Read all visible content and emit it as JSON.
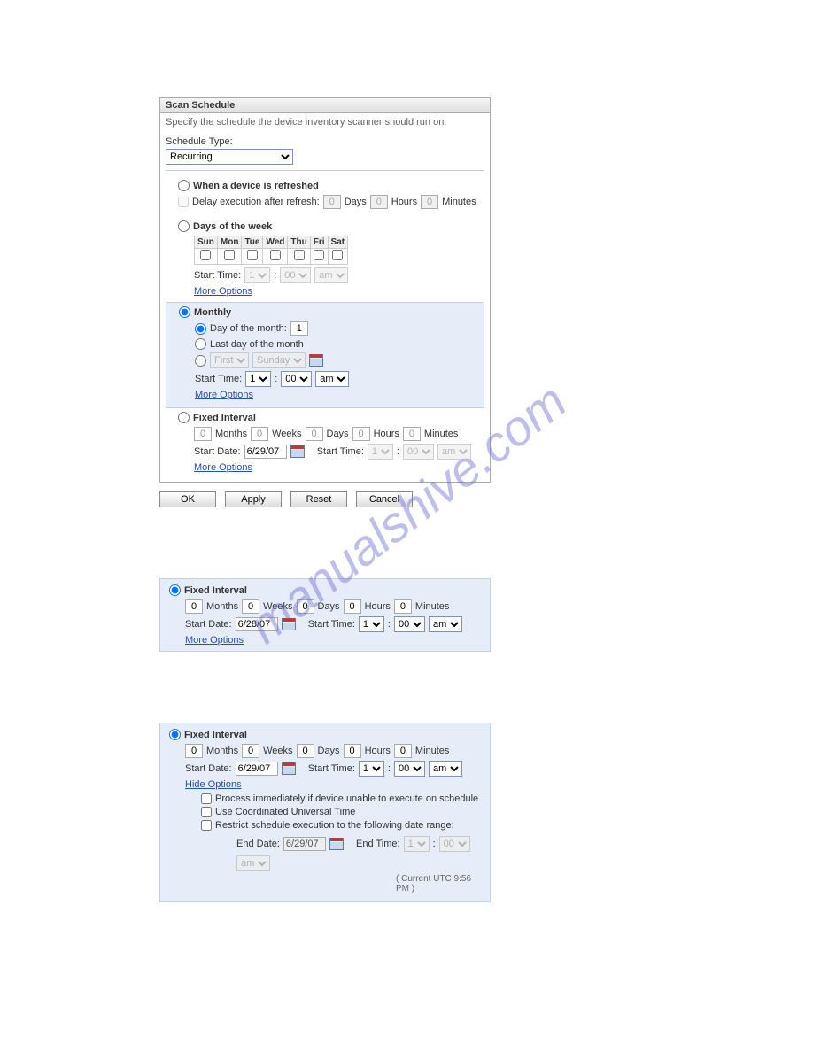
{
  "watermark": "manualshive.com",
  "main": {
    "title": "Scan Schedule",
    "instruction": "Specify the schedule the device inventory scanner should run on:",
    "schedule_type_label": "Schedule Type:",
    "schedule_type_value": "Recurring",
    "refresh": {
      "label": "When a device is refreshed",
      "delay_label": "Delay execution after refresh:",
      "days": "0",
      "days_label": "Days",
      "hours": "0",
      "hours_label": "Hours",
      "minutes": "0",
      "minutes_label": "Minutes"
    },
    "dow": {
      "label": "Days of the week",
      "headers": [
        "Sun",
        "Mon",
        "Tue",
        "Wed",
        "Thu",
        "Fri",
        "Sat"
      ],
      "start_time_label": "Start Time:",
      "hour": "1",
      "minute": "00",
      "ampm": "am",
      "more": "More Options"
    },
    "monthly": {
      "label": "Monthly",
      "day_of_month_label": "Day of the month:",
      "day_of_month_value": "1",
      "last_day_label": "Last day of the month",
      "ordinal": "First",
      "weekday": "Sunday",
      "start_time_label": "Start Time:",
      "hour": "1",
      "minute": "00",
      "ampm": "am",
      "more": "More Options"
    },
    "fixed": {
      "label": "Fixed Interval",
      "months": "0",
      "months_label": "Months",
      "weeks": "0",
      "weeks_label": "Weeks",
      "days": "0",
      "days_label": "Days",
      "hours": "0",
      "hours_label": "Hours",
      "minutes": "0",
      "minutes_label": "Minutes",
      "start_date_label": "Start Date:",
      "start_date": "6/29/07",
      "start_time_label": "Start Time:",
      "hour": "1",
      "minute": "00",
      "ampm": "am",
      "more": "More Options"
    },
    "buttons": {
      "ok": "OK",
      "apply": "Apply",
      "reset": "Reset",
      "cancel": "Cancel"
    }
  },
  "block2": {
    "label": "Fixed Interval",
    "months": "0",
    "months_label": "Months",
    "weeks": "0",
    "weeks_label": "Weeks",
    "days": "0",
    "days_label": "Days",
    "hours": "0",
    "hours_label": "Hours",
    "minutes": "0",
    "minutes_label": "Minutes",
    "start_date_label": "Start Date:",
    "start_date": "6/28/07",
    "start_time_label": "Start Time:",
    "hour": "1",
    "minute": "00",
    "ampm": "am",
    "more": "More Options"
  },
  "block3": {
    "label": "Fixed Interval",
    "months": "0",
    "months_label": "Months",
    "weeks": "0",
    "weeks_label": "Weeks",
    "days": "0",
    "days_label": "Days",
    "hours": "0",
    "hours_label": "Hours",
    "minutes": "0",
    "minutes_label": "Minutes",
    "start_date_label": "Start Date:",
    "start_date": "6/29/07",
    "start_time_label": "Start Time:",
    "hour": "1",
    "minute": "00",
    "ampm": "am",
    "hide": "Hide Options",
    "opt1": "Process immediately if device unable to execute on schedule",
    "opt2": "Use Coordinated Universal Time",
    "opt3": "Restrict schedule execution to the following date range:",
    "end_date_label": "End Date:",
    "end_date": "6/29/07",
    "end_time_label": "End Time:",
    "end_hour": "1",
    "end_minute": "00",
    "end_ampm": "am",
    "current_utc": "( Current UTC 9:56 PM )"
  }
}
